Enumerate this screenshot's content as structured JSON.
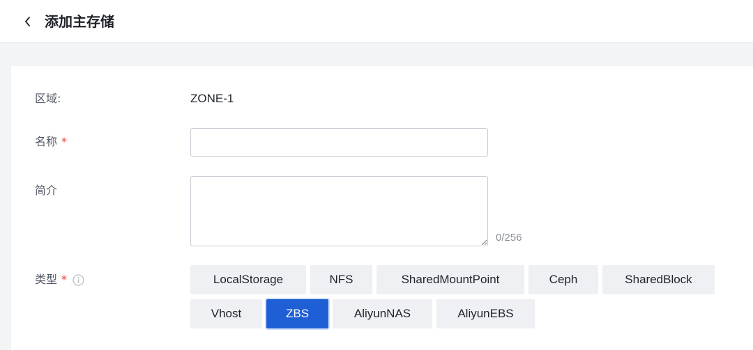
{
  "header": {
    "title": "添加主存储"
  },
  "form": {
    "zone_label": "区域:",
    "zone_value": "ZONE-1",
    "name_label": "名称",
    "name_value": "",
    "desc_label": "简介",
    "desc_value": "",
    "desc_counter": "0/256",
    "type_label": "类型",
    "required_mark": "*",
    "types": [
      "LocalStorage",
      "NFS",
      "SharedMountPoint",
      "Ceph",
      "SharedBlock",
      "Vhost",
      "ZBS",
      "AliyunNAS",
      "AliyunEBS"
    ],
    "selected_type": "ZBS"
  },
  "colors": {
    "accent": "#1f5fd6",
    "required": "#f04134"
  }
}
